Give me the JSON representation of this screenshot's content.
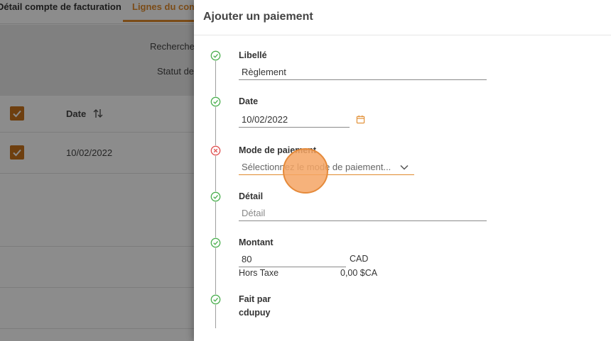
{
  "background": {
    "tabs": [
      {
        "label": "Détail compte de facturation"
      },
      {
        "label": "Lignes du compte"
      }
    ],
    "filters": {
      "search_label": "Recherche",
      "status_label": "Statut de"
    },
    "table": {
      "date_header": "Date",
      "rows": [
        {
          "date": "10/02/2022",
          "checked": true
        }
      ]
    }
  },
  "dialog": {
    "title": "Ajouter un paiement",
    "fields": {
      "libelle": {
        "label": "Libellé",
        "value": "Règlement",
        "status": "valid"
      },
      "date": {
        "label": "Date",
        "value": "10/02/2022",
        "status": "valid"
      },
      "mode_paiement": {
        "label": "Mode de paiement",
        "placeholder": "Sélectionnez le mode de paiement...",
        "status": "error"
      },
      "detail": {
        "label": "Détail",
        "placeholder": "Détail",
        "status": "valid"
      },
      "montant": {
        "label": "Montant",
        "value": "80",
        "currency": "CAD",
        "hors_taxe_label": "Hors Taxe",
        "hors_taxe_value": "0,00 $CA",
        "status": "valid"
      },
      "fait_par": {
        "label": "Fait par",
        "value": "cdupuy",
        "status": "valid"
      }
    }
  },
  "colors": {
    "accent": "#e08a2c",
    "valid": "#4caf50",
    "error": "#e05252"
  }
}
